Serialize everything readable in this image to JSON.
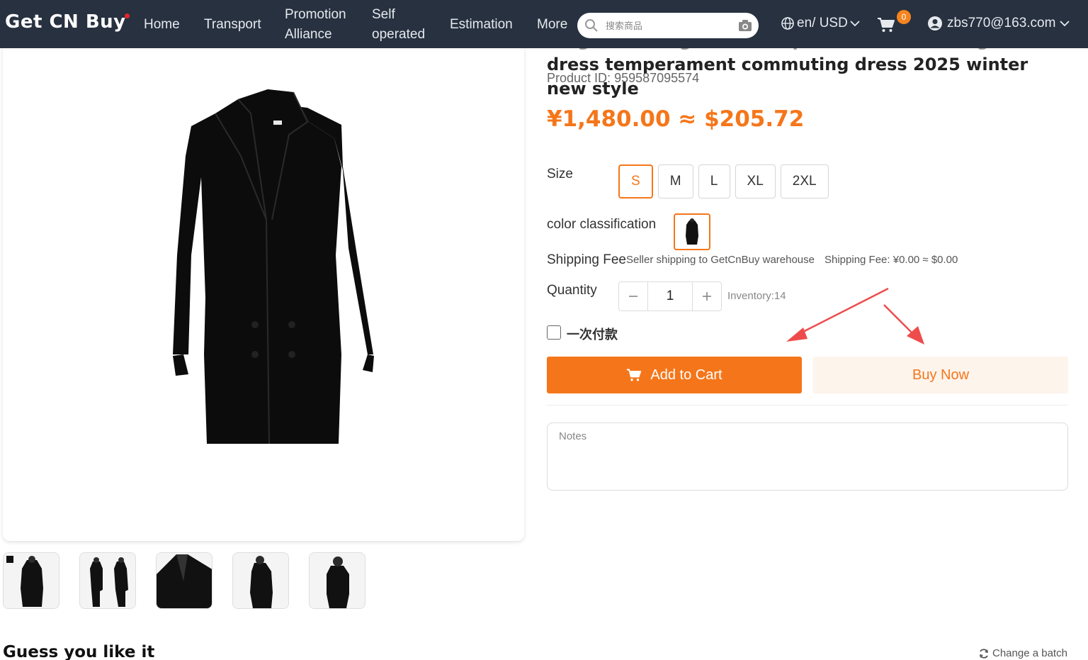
{
  "nav": {
    "logo": "Get CN Buy",
    "items": [
      "Home",
      "Transport",
      "Promotion",
      "Alliance",
      "Self",
      "operated",
      "Estimation",
      "More"
    ],
    "search_placeholder": "搜索商品",
    "lang": "en/ USD",
    "cart_count": "0",
    "user": "zbs770@163.com"
  },
  "product": {
    "title_line1": "Large size elegant and capable waist cinching",
    "title_line2": "dress temperament commuting dress 2025 winter new style",
    "id_label": "Product ID:",
    "id": "959587095574",
    "price": "¥1,480.00 ≈ $205.72",
    "size_label": "Size",
    "sizes": [
      "S",
      "M",
      "L",
      "XL",
      "2XL"
    ],
    "selected_size": "S",
    "color_label": "color classification",
    "shipping_label": "Shipping Fee",
    "shipping_method": "Seller shipping to GetCnBuy warehouse",
    "shipping_fee": "Shipping Fee: ¥0.00 ≈ $0.00",
    "quantity_label": "Quantity",
    "quantity": "1",
    "inventory": "Inventory:14",
    "one_time_payment": "一次付款",
    "add_to_cart": "Add to Cart",
    "buy_now": "Buy Now",
    "notes_placeholder": "Notes"
  },
  "recommend": {
    "title": "Guess you like it",
    "change_batch": "Change a batch"
  },
  "colors": {
    "nav_bg": "#273140",
    "accent": "#f5761a",
    "buy_bg": "#fdf4ec",
    "annotation": "#ee4c4c"
  }
}
